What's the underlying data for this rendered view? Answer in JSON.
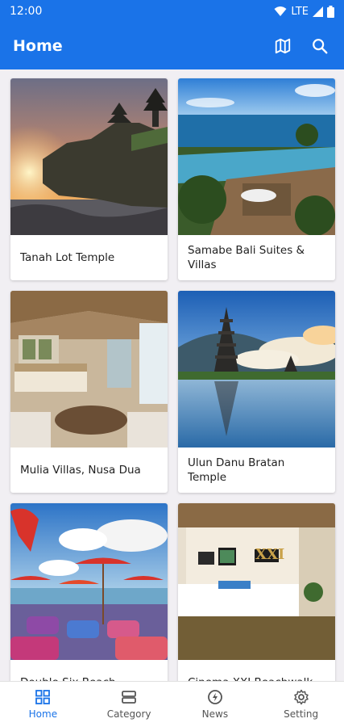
{
  "status_bar": {
    "time": "12:00",
    "network": "LTE"
  },
  "app_bar": {
    "title": "Home",
    "actions": [
      "map-icon",
      "search-icon"
    ]
  },
  "places": [
    {
      "title": "Tanah Lot Temple"
    },
    {
      "title": "Samabe Bali Suites & Villas"
    },
    {
      "title": "Mulia Villas, Nusa Dua"
    },
    {
      "title": "Ulun Danu Bratan Temple"
    },
    {
      "title": "Double Six Beach"
    },
    {
      "title": "Cinema XXI Beachwalk"
    }
  ],
  "bottom_nav": {
    "items": [
      {
        "label": "Home",
        "icon": "grid-icon",
        "active": true
      },
      {
        "label": "Category",
        "icon": "list-icon",
        "active": false
      },
      {
        "label": "News",
        "icon": "bolt-icon",
        "active": false
      },
      {
        "label": "Setting",
        "icon": "gear-icon",
        "active": false
      }
    ]
  },
  "colors": {
    "primary": "#1a73e8",
    "background": "#f1eff3"
  }
}
